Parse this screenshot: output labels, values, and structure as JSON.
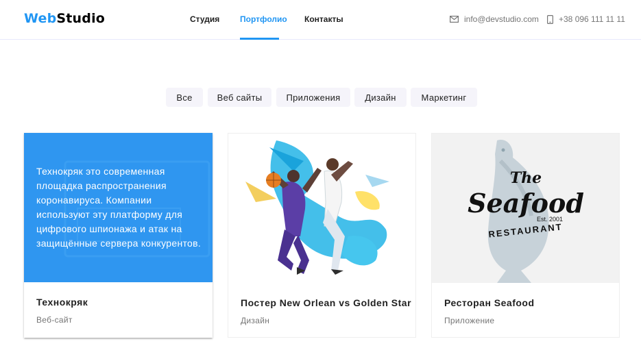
{
  "header": {
    "logo_part1": "Web",
    "logo_part2": "Studio",
    "nav": [
      "Студия",
      "Портфолио",
      "Контакты"
    ],
    "active_nav": "Портфолио",
    "email": "info@devstudio.com",
    "phone": "+38 096 111 11 11",
    "icons": {
      "email": "mail-icon",
      "phone": "phone-icon"
    },
    "colors": {
      "accent": "#2196f3"
    }
  },
  "filters": [
    "Все",
    "Веб сайты",
    "Приложения",
    "Дизайн",
    "Маркетинг"
  ],
  "cards": [
    {
      "title": "Технокряк",
      "category": "Веб-сайт",
      "overlay_text": "Технокряк это современная площадка распространения коронавируса. Компании используют эту платформу для цифрового шпионажа и атак на защищённые сервера конкурентов."
    },
    {
      "title": "Постер New Orlean vs Golden Star",
      "category": "Дизайн"
    },
    {
      "title": "Ресторан Seafood",
      "category": "Приложение",
      "logo": {
        "line1": "The",
        "line2": "Seafood",
        "est": "Est. 2001",
        "line3": "RESTAURANT"
      }
    }
  ]
}
